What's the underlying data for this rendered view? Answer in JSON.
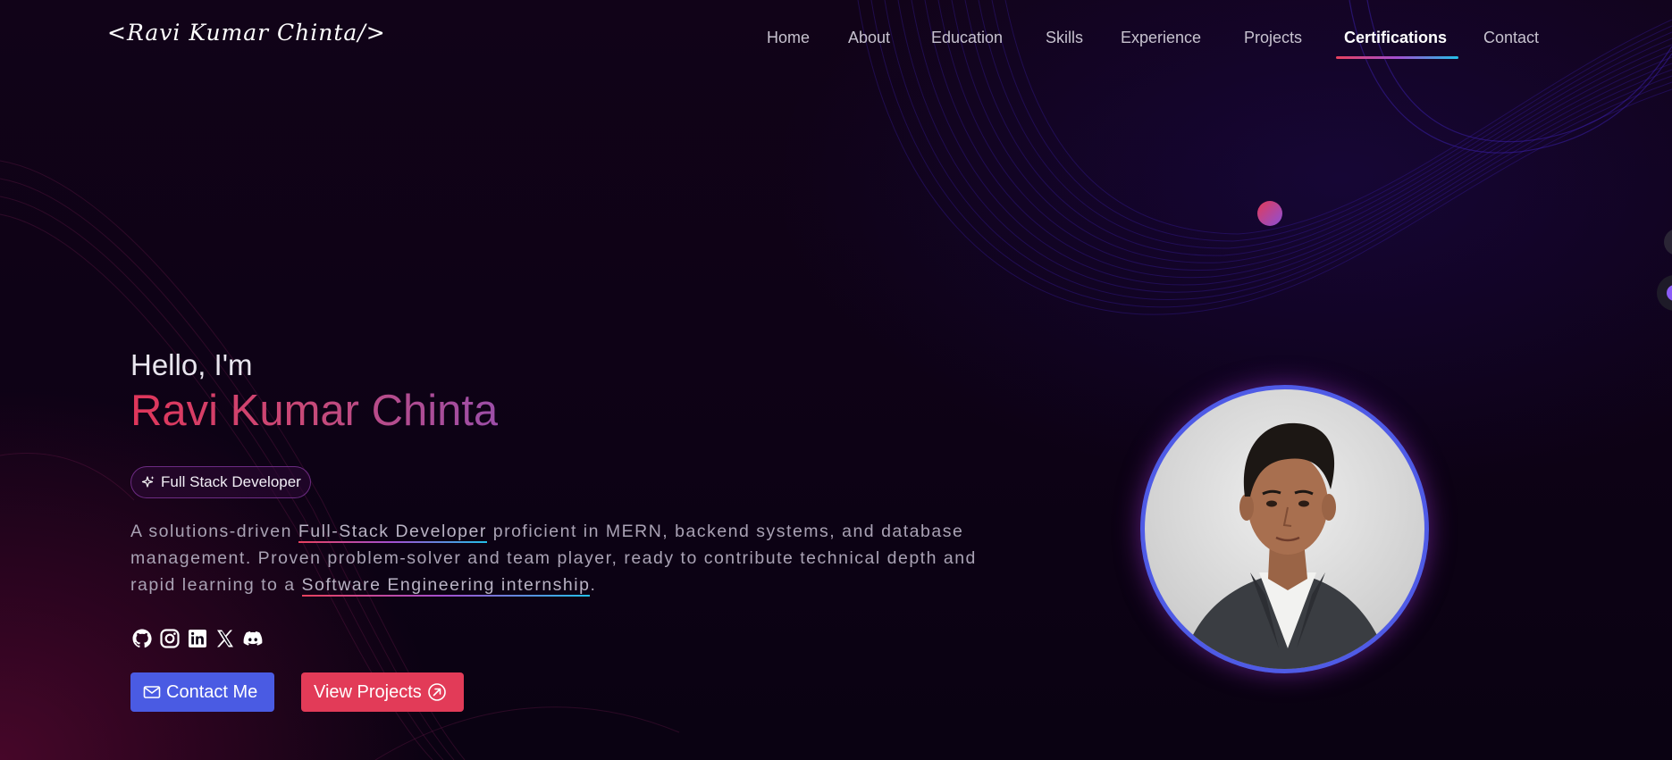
{
  "logo": {
    "text": "<Ravi Kumar Chinta/>"
  },
  "nav": {
    "items": [
      {
        "label": "Home"
      },
      {
        "label": "About"
      },
      {
        "label": "Education"
      },
      {
        "label": "Skills"
      },
      {
        "label": "Experience"
      },
      {
        "label": "Projects"
      },
      {
        "label": "Certifications",
        "active": true
      },
      {
        "label": "Contact"
      }
    ]
  },
  "hero": {
    "greeting": "Hello, I'm",
    "name": "Ravi Kumar Chinta",
    "role_badge": "Full Stack Developer",
    "description": {
      "part1": "A solutions-driven ",
      "highlight1": "Full-Stack Developer",
      "part2": " proficient in MERN, backend systems, and database management. Proven problem-solver and team player, ready to contribute technical depth and rapid learning to a ",
      "highlight2": "Software Engineering internship",
      "part3": "."
    },
    "socials": [
      {
        "icon": "github-icon"
      },
      {
        "icon": "instagram-icon"
      },
      {
        "icon": "linkedin-icon"
      },
      {
        "icon": "x-twitter-icon"
      },
      {
        "icon": "discord-icon"
      }
    ],
    "buttons": {
      "contact_label": "Contact Me",
      "projects_label": "View Projects"
    }
  },
  "colors": {
    "accent_blue": "#4a5be3",
    "accent_red": "#e23b58",
    "name_gradient_start": "#e0365a",
    "name_gradient_end": "#9c4ea8",
    "underline_gradient": [
      "#e8415d",
      "#a24fd0",
      "#22c0e8"
    ]
  }
}
